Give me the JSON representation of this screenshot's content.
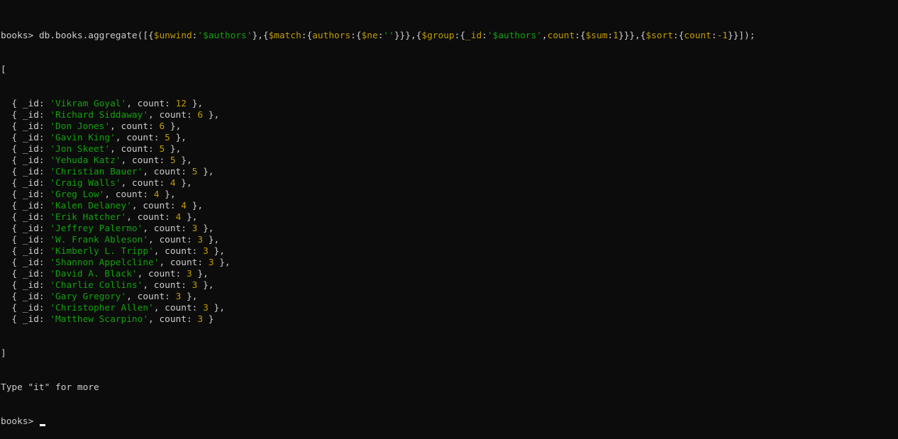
{
  "terminal": {
    "prompt": "books> ",
    "command_parts": [
      {
        "t": "db.books.aggregate([{",
        "c": "plain"
      },
      {
        "t": "$unwind",
        "c": "num"
      },
      {
        "t": ":",
        "c": "plain"
      },
      {
        "t": "'$authors'",
        "c": "str"
      },
      {
        "t": "},{",
        "c": "plain"
      },
      {
        "t": "$match",
        "c": "num"
      },
      {
        "t": ":{",
        "c": "plain"
      },
      {
        "t": "authors",
        "c": "num"
      },
      {
        "t": ":{",
        "c": "plain"
      },
      {
        "t": "$ne",
        "c": "num"
      },
      {
        "t": ":",
        "c": "plain"
      },
      {
        "t": "''",
        "c": "str"
      },
      {
        "t": "}}},{",
        "c": "plain"
      },
      {
        "t": "$group",
        "c": "num"
      },
      {
        "t": ":{",
        "c": "plain"
      },
      {
        "t": "_id",
        "c": "num"
      },
      {
        "t": ":",
        "c": "plain"
      },
      {
        "t": "'$authors'",
        "c": "str"
      },
      {
        "t": ",",
        "c": "plain"
      },
      {
        "t": "count",
        "c": "num"
      },
      {
        "t": ":{",
        "c": "plain"
      },
      {
        "t": "$sum",
        "c": "num"
      },
      {
        "t": ":",
        "c": "plain"
      },
      {
        "t": "1",
        "c": "num"
      },
      {
        "t": "}}},{",
        "c": "plain"
      },
      {
        "t": "$sort",
        "c": "num"
      },
      {
        "t": ":{",
        "c": "plain"
      },
      {
        "t": "count",
        "c": "num"
      },
      {
        "t": ":",
        "c": "plain"
      },
      {
        "t": "-1",
        "c": "num"
      },
      {
        "t": "}}]);",
        "c": "plain"
      }
    ],
    "open_bracket": "[",
    "close_bracket": "]",
    "results": [
      {
        "id": "'Vikram Goyal'",
        "count": "12"
      },
      {
        "id": "'Richard Siddaway'",
        "count": "6"
      },
      {
        "id": "'Don Jones'",
        "count": "6"
      },
      {
        "id": "'Gavin King'",
        "count": "5"
      },
      {
        "id": "'Jon Skeet'",
        "count": "5"
      },
      {
        "id": "'Yehuda Katz'",
        "count": "5"
      },
      {
        "id": "'Christian Bauer'",
        "count": "5"
      },
      {
        "id": "'Craig Walls'",
        "count": "4"
      },
      {
        "id": "'Greg Low'",
        "count": "4"
      },
      {
        "id": "'Kalen Delaney'",
        "count": "4"
      },
      {
        "id": "'Erik Hatcher'",
        "count": "4"
      },
      {
        "id": "'Jeffrey Palermo'",
        "count": "3"
      },
      {
        "id": "'W. Frank Ableson'",
        "count": "3"
      },
      {
        "id": "'Kimberly L. Tripp'",
        "count": "3"
      },
      {
        "id": "'Shannon Appelcline'",
        "count": "3"
      },
      {
        "id": "'David A. Black'",
        "count": "3"
      },
      {
        "id": "'Charlie Collins'",
        "count": "3"
      },
      {
        "id": "'Gary Gregory'",
        "count": "3"
      },
      {
        "id": "'Christopher Allen'",
        "count": "3"
      },
      {
        "id": "'Matthew Scarpino'",
        "count": "3"
      }
    ],
    "row_prefix": "  { _id: ",
    "row_mid": ", count: ",
    "row_end_more": " },",
    "row_end_last": " }",
    "more_message": "Type \"it\" for more",
    "final_prompt": "books> ",
    "colors": {
      "background": "#0c0c0c",
      "text": "#cccccc",
      "string": "#13a10e",
      "number": "#c19c00",
      "cursor": "#ffffff"
    }
  }
}
